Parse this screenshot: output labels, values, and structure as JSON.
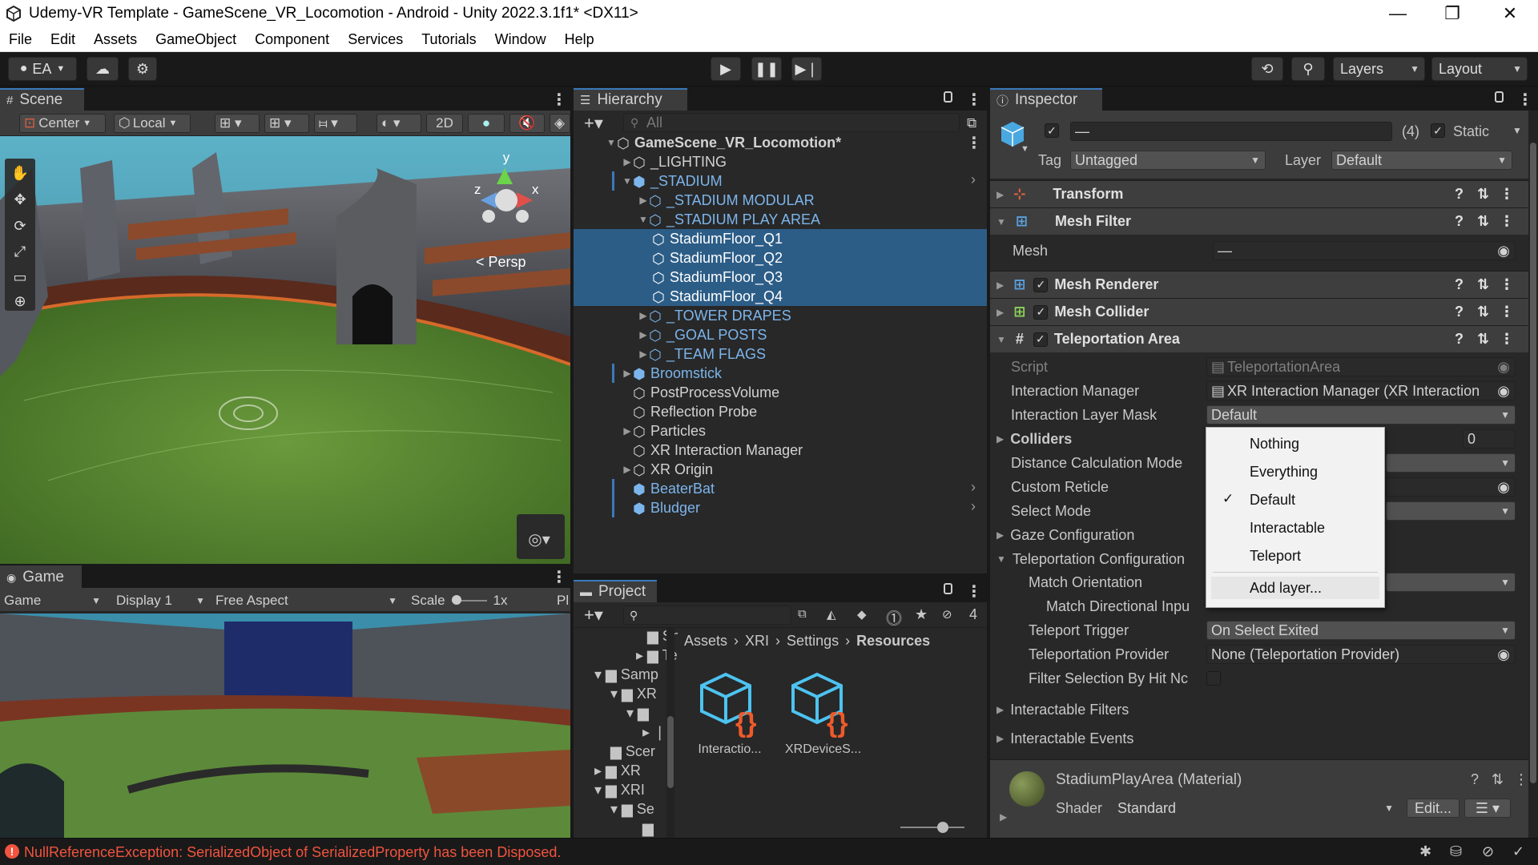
{
  "window": {
    "title": "Udemy-VR Template - GameScene_VR_Locomotion - Android - Unity 2022.3.1f1* <DX11>"
  },
  "menu": [
    "File",
    "Edit",
    "Assets",
    "GameObject",
    "Component",
    "Services",
    "Tutorials",
    "Window",
    "Help"
  ],
  "toolbar": {
    "account": "EA",
    "layers": "Layers",
    "layout": "Layout"
  },
  "scene": {
    "tab": "Scene",
    "pivot": "Center",
    "space": "Local",
    "mode2d": "2D",
    "persp": "< Persp",
    "axis_y": "y",
    "axis_x": "x",
    "axis_z": "z"
  },
  "game": {
    "tab": "Game",
    "view": "Game",
    "display": "Display 1",
    "aspect": "Free Aspect",
    "scale_label": "Scale",
    "scale_value": "1x",
    "play_label": "Pl"
  },
  "hierarchy": {
    "tab": "Hierarchy",
    "search_placeholder": "All",
    "rows": [
      {
        "label": "GameScene_VR_Locomotion*"
      },
      {
        "label": "_LIGHTING"
      },
      {
        "label": "_STADIUM"
      },
      {
        "label": "_STADIUM MODULAR"
      },
      {
        "label": "_STADIUM PLAY AREA"
      },
      {
        "label": "StadiumFloor_Q1"
      },
      {
        "label": "StadiumFloor_Q2"
      },
      {
        "label": "StadiumFloor_Q3"
      },
      {
        "label": "StadiumFloor_Q4"
      },
      {
        "label": "_TOWER DRAPES"
      },
      {
        "label": "_GOAL POSTS"
      },
      {
        "label": "_TEAM FLAGS"
      },
      {
        "label": "Broomstick"
      },
      {
        "label": "PostProcessVolume"
      },
      {
        "label": "Reflection Probe"
      },
      {
        "label": "Particles"
      },
      {
        "label": "XR Interaction Manager"
      },
      {
        "label": "XR Origin"
      },
      {
        "label": "BeaterBat"
      },
      {
        "label": "Bludger"
      }
    ]
  },
  "project": {
    "tab": "Project",
    "hidden_count": "4",
    "breadcrumb": [
      "Assets",
      "XRI",
      "Settings",
      "Resources"
    ],
    "tree": [
      "Sh",
      "Te",
      "Samp",
      "XR",
      "Scer",
      "XR",
      "XRI",
      "Se"
    ],
    "assets": [
      {
        "label": "Interactio..."
      },
      {
        "label": "XRDeviceS..."
      }
    ]
  },
  "inspector": {
    "tab": "Inspector",
    "name_value": "—",
    "count": "(4)",
    "static_label": "Static",
    "tag_label": "Tag",
    "tag_value": "Untagged",
    "layer_label": "Layer",
    "layer_value": "Default",
    "components": {
      "transform": "Transform",
      "mesh_filter": "Mesh Filter",
      "mesh_renderer": "Mesh Renderer",
      "mesh_collider": "Mesh Collider",
      "teleportation_area": "Teleportation Area"
    },
    "mesh_label": "Mesh",
    "mesh_value": "—",
    "props": {
      "script": "Script",
      "script_value": "TeleportationArea",
      "interaction_manager": "Interaction Manager",
      "interaction_manager_value": "XR Interaction Manager (XR Interaction",
      "layer_mask": "Interaction Layer Mask",
      "layer_mask_value": "Default",
      "colliders": "Colliders",
      "colliders_count": "0",
      "distance_mode": "Distance Calculation Mode",
      "custom_reticle": "Custom Reticle",
      "select_mode": "Select Mode",
      "gaze": "Gaze Configuration",
      "teleport_config": "Teleportation Configuration",
      "match_orientation": "Match Orientation",
      "match_directional": "Match Directional Inpu",
      "teleport_trigger": "Teleport Trigger",
      "teleport_trigger_value": "On Select Exited",
      "teleport_provider": "Teleportation Provider",
      "teleport_provider_value": "None (Teleportation Provider)",
      "filter_selection": "Filter Selection By Hit Nc",
      "interactable_filters": "Interactable Filters",
      "interactable_events": "Interactable Events"
    },
    "material": {
      "name": "StadiumPlayArea (Material)",
      "shader_label": "Shader",
      "shader_value": "Standard",
      "edit": "Edit..."
    }
  },
  "dropdown": {
    "options": [
      "Nothing",
      "Everything",
      "Default",
      "Interactable",
      "Teleport"
    ],
    "selected": "Default",
    "add": "Add layer..."
  },
  "status": {
    "error": "NullReferenceException: SerializedObject of SerializedProperty has been Disposed."
  },
  "colors": {
    "selection": "#2c5d87",
    "prefab_blue": "#7cb5ec",
    "error": "#f1543f",
    "panel": "#282828"
  }
}
